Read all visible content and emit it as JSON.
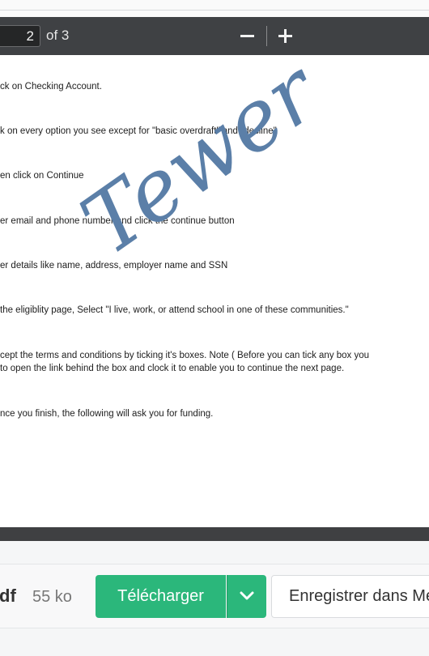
{
  "viewer": {
    "current_page": "2",
    "page_total": "of 3",
    "zoom_out_icon": "minus-icon",
    "zoom_in_icon": "plus-icon"
  },
  "document": {
    "lines": [
      "ck on Checking Account.",
      "k on every option you see except for \"basic overdraft\" and \"decline\"",
      "en click on Continue",
      "er email and phone number and click the continue button",
      "er details like name, address, employer name and SSN",
      " the eligiblity page, Select \"I live, work, or attend school in one of these communities.\"",
      "cept the terms and conditions by ticking it's boxes. Note ( Before you can tick any box you",
      "to open the link behind the box and clock it to enable you to continue the next page.",
      "nce you finish, the following will ask you for funding."
    ],
    "watermark": "Tewer",
    "watermark_color": "#5b7fa8"
  },
  "download_bar": {
    "file_ext": "df",
    "file_size": "55 ko",
    "download_label": "Télécharger",
    "dropdown_icon": "chevron-down-icon",
    "save_label": "Enregistrer dans Mega",
    "accent_color": "#2bb77b"
  }
}
